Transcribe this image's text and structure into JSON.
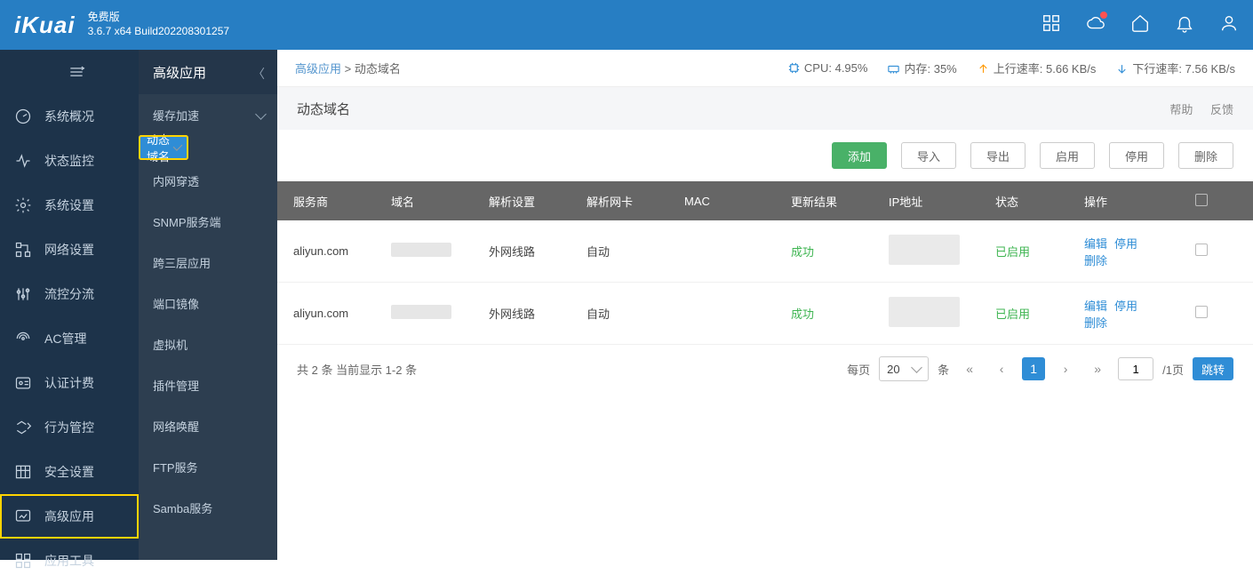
{
  "header": {
    "logo": "iKuai",
    "edition": "免费版",
    "build": "3.6.7 x64 Build202208301257"
  },
  "nav1": [
    {
      "key": "overview",
      "label": "系统概况"
    },
    {
      "key": "monitor",
      "label": "状态监控"
    },
    {
      "key": "settings",
      "label": "系统设置"
    },
    {
      "key": "network",
      "label": "网络设置"
    },
    {
      "key": "flow",
      "label": "流控分流"
    },
    {
      "key": "ac",
      "label": "AC管理"
    },
    {
      "key": "auth",
      "label": "认证计费"
    },
    {
      "key": "behavior",
      "label": "行为管控"
    },
    {
      "key": "security",
      "label": "安全设置"
    },
    {
      "key": "advanced",
      "label": "高级应用"
    },
    {
      "key": "tools",
      "label": "应用工具"
    }
  ],
  "nav2": {
    "title": "高级应用",
    "items": [
      {
        "label": "缓存加速",
        "caret": true
      },
      {
        "label": "动态域名",
        "selected": true
      },
      {
        "label": "内网穿透"
      },
      {
        "label": "SNMP服务端"
      },
      {
        "label": "跨三层应用"
      },
      {
        "label": "端口镜像"
      },
      {
        "label": "虚拟机"
      },
      {
        "label": "插件管理"
      },
      {
        "label": "网络唤醒"
      },
      {
        "label": "FTP服务"
      },
      {
        "label": "Samba服务"
      }
    ]
  },
  "breadcrumb": {
    "a": "高级应用",
    "sep": ">",
    "b": "动态域名"
  },
  "stats": {
    "cpu_label": "CPU:",
    "cpu": "4.95%",
    "mem_label": "内存:",
    "mem": "35%",
    "up_label": "上行速率:",
    "up": "5.66 KB/s",
    "down_label": "下行速率:",
    "down": "7.56 KB/s"
  },
  "page": {
    "title": "动态域名",
    "help": "帮助",
    "feedback": "反馈"
  },
  "toolbar": {
    "add": "添加",
    "import": "导入",
    "export": "导出",
    "enable": "启用",
    "disable": "停用",
    "delete": "删除"
  },
  "columns": {
    "provider": "服务商",
    "domain": "域名",
    "resolve": "解析设置",
    "nic": "解析网卡",
    "mac": "MAC",
    "result": "更新结果",
    "ip": "IP地址",
    "status": "状态",
    "op": "操作"
  },
  "rows": [
    {
      "provider": "aliyun.com",
      "resolve": "外网线路",
      "nic": "自动",
      "result": "成功",
      "status": "已启用",
      "ops": {
        "edit": "编辑",
        "disable": "停用",
        "delete": "删除"
      }
    },
    {
      "provider": "aliyun.com",
      "resolve": "外网线路",
      "nic": "自动",
      "result": "成功",
      "status": "已启用",
      "ops": {
        "edit": "编辑",
        "disable": "停用",
        "delete": "删除"
      }
    }
  ],
  "pager": {
    "summary": "共 2 条  当前显示 1-2 条",
    "per_label": "每页",
    "per": "20",
    "per_unit": "条",
    "current": "1",
    "pageinput": "1",
    "total": "/1页",
    "jump": "跳转"
  }
}
